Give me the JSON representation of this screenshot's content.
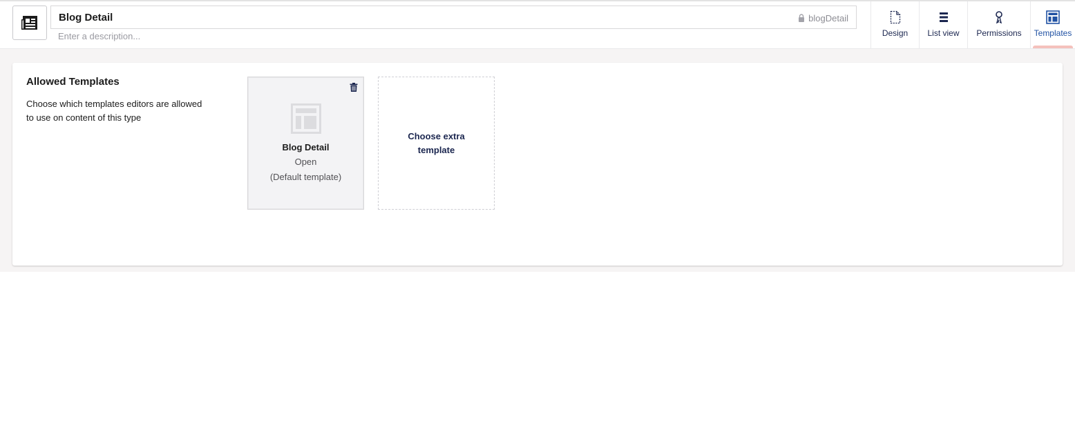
{
  "header": {
    "name_value": "Blog Detail",
    "alias": "blogDetail",
    "description_placeholder": "Enter a description...",
    "icon": "newspaper-icon"
  },
  "apps": [
    {
      "label": "Design",
      "icon": "document-icon",
      "active": false
    },
    {
      "label": "List view",
      "icon": "list-icon",
      "active": false
    },
    {
      "label": "Permissions",
      "icon": "key-icon",
      "active": false
    },
    {
      "label": "Templates",
      "icon": "layout-icon",
      "active": true
    }
  ],
  "templates_section": {
    "title": "Allowed Templates",
    "description": "Choose which templates editors are allowed to use on content of this type",
    "template_card": {
      "name": "Blog Detail",
      "open_label": "Open",
      "default_label": "(Default template)"
    },
    "add_label": "Choose extra template"
  },
  "colors": {
    "accent": "#2152a3",
    "active_indicator": "#f5c1bc",
    "background": "#f6f4f4"
  }
}
